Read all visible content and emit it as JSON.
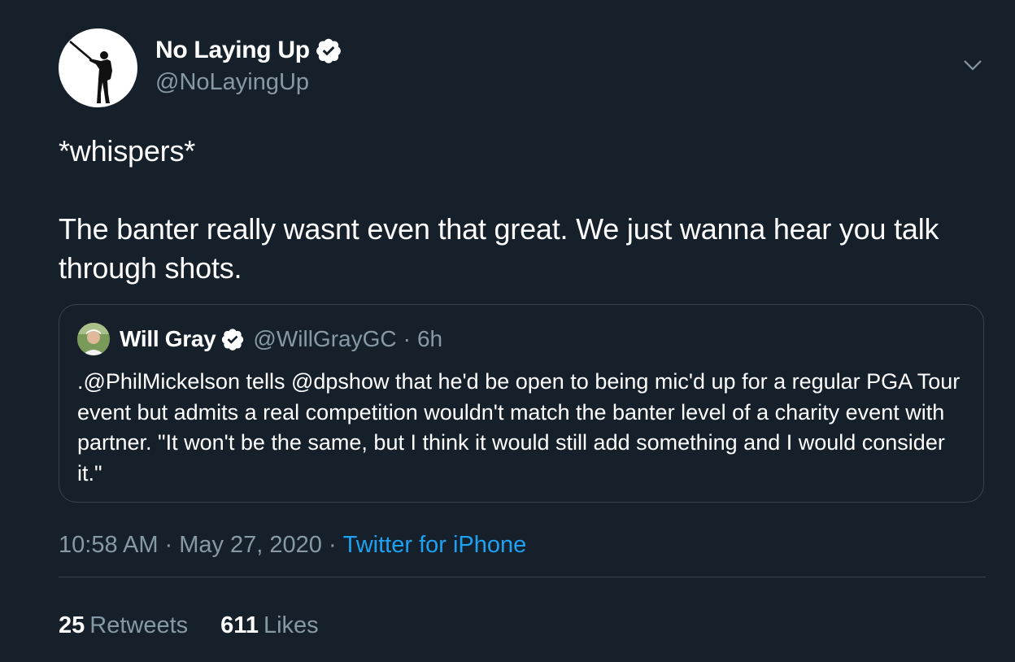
{
  "author": {
    "display_name": "No Laying Up",
    "handle": "@NoLayingUp",
    "verified": true,
    "avatar_icon": "golfer-silhouette-avatar"
  },
  "tweet": {
    "text": "*whispers*\n\nThe banter really wasnt even that great. We just wanna hear you talk through shots."
  },
  "quoted_tweet": {
    "display_name": "Will Gray",
    "handle": "@WillGrayGC",
    "separator": "·",
    "time": "6h",
    "verified": true,
    "text": ".@PhilMickelson tells @dpshow that he'd be open to being mic'd up for a regular PGA Tour event but admits a real competition wouldn't match the banter level of a charity event with partner. \"It won't be the same, but I think it would still add something and I would consider it.\""
  },
  "meta": {
    "time": "10:58 AM",
    "separator": "·",
    "date": "May 27, 2020",
    "source": "Twitter for iPhone"
  },
  "stats": {
    "retweets_count": "25",
    "retweets_label": "Retweets",
    "likes_count": "611",
    "likes_label": "Likes"
  },
  "colors": {
    "background": "#15202b",
    "text_primary": "#ffffff",
    "text_secondary": "#8899a6",
    "accent": "#1da1f2",
    "border": "#38444d"
  }
}
